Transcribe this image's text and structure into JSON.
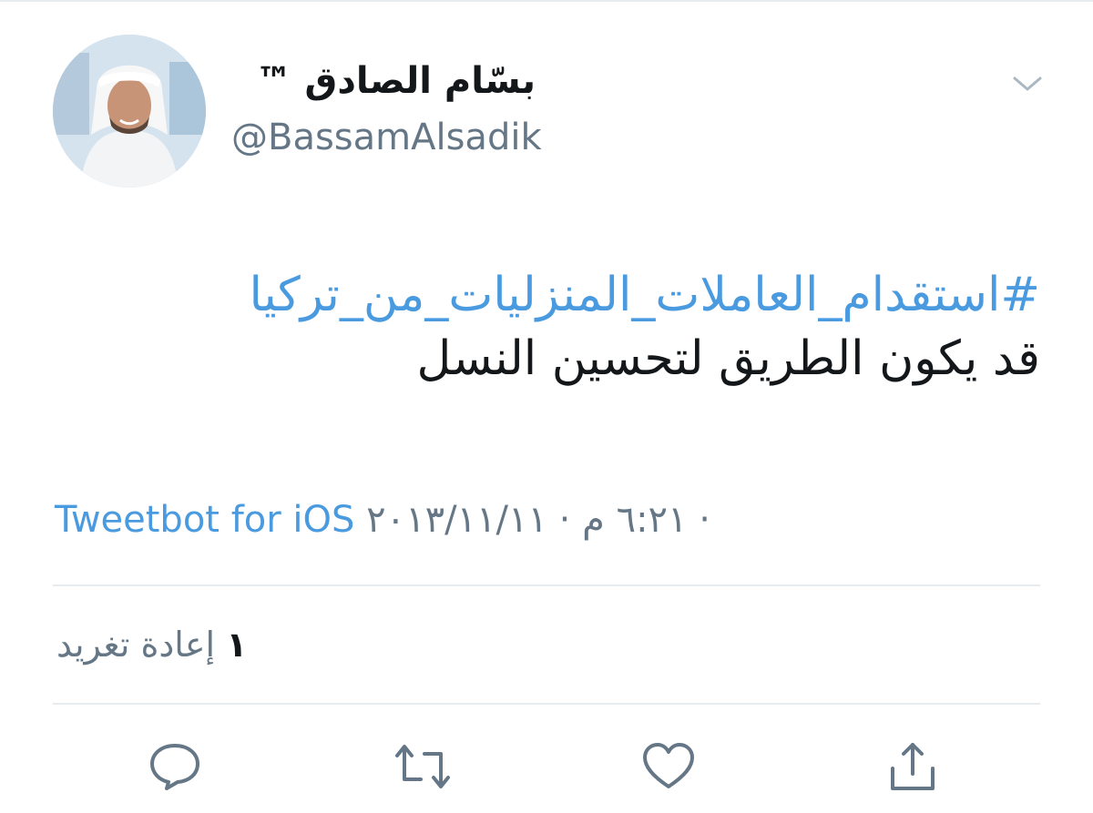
{
  "tweet": {
    "author": {
      "display_name": "بسّام الصادق ™",
      "handle": "@BassamAlsadik"
    },
    "hashtag": "#استقدام_العاملات_المنزليات_من_تركيا",
    "text": "قد يكون الطريق لتحسين النسل",
    "timestamp": "٦:٢١ م · ٢٠١٣/١١/١١ ·",
    "source": "Tweetbot for iOS",
    "retweets": {
      "count": "١",
      "label": "إعادة تغريد"
    }
  },
  "icons": {
    "menu": "chevron-down-icon",
    "reply": "reply-icon",
    "retweet": "retweet-icon",
    "like": "heart-icon",
    "share": "share-icon"
  },
  "colors": {
    "link": "#4a9ae0",
    "text": "#14171a",
    "secondary": "#657786",
    "divider": "#e6ecf0"
  }
}
